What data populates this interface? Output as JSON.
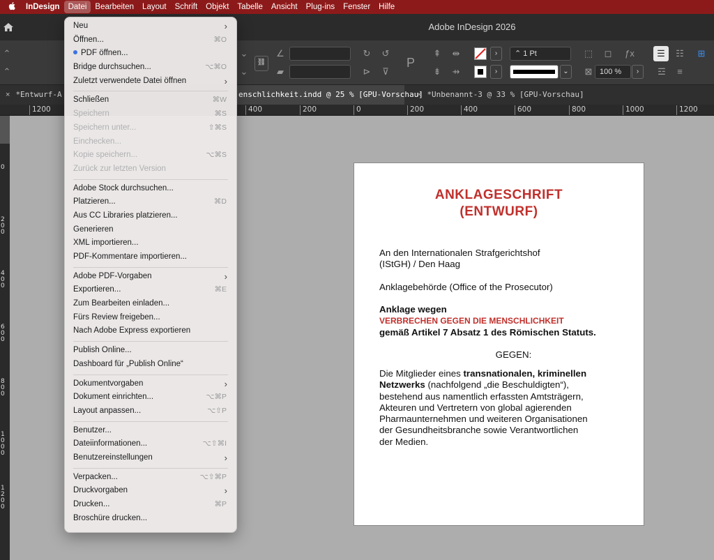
{
  "menubar": {
    "apple_icon": "",
    "items": [
      "InDesign",
      "Datei",
      "Bearbeiten",
      "Layout",
      "Schrift",
      "Objekt",
      "Tabelle",
      "Ansicht",
      "Plug-ins",
      "Fenster",
      "Hilfe"
    ],
    "active": "Datei",
    "bg_color": "#8d1a1a"
  },
  "window": {
    "title": "Adobe InDesign 2026"
  },
  "control_bar": {
    "stroke_weight": "1 Pt",
    "zoom": "100 %"
  },
  "tabs": [
    {
      "label": "*Entwurf-A",
      "close": "×"
    },
    {
      "label": "enschlichkeit.indd @ 25 % [GPU-Vorschau]",
      "close": ""
    },
    {
      "label": "*Unbenannt-3 @ 33 % [GPU-Vorschau]",
      "close": "×"
    }
  ],
  "ruler": {
    "ticks": [
      "1200",
      "400",
      "200",
      "0",
      "200",
      "400",
      "600",
      "800",
      "1000",
      "1200"
    ],
    "vticks": [
      [
        "0"
      ],
      [
        "2",
        "0",
        "0"
      ],
      [
        "4",
        "0",
        "0"
      ],
      [
        "6",
        "0",
        "0"
      ],
      [
        "8",
        "0",
        "0"
      ],
      [
        "1",
        "0",
        "0",
        "0"
      ],
      [
        "1",
        "2",
        "0",
        "0"
      ]
    ]
  },
  "menu": {
    "groups": [
      [
        {
          "label": "Neu",
          "shortcut": "",
          "submenu": true,
          "disabled": false
        },
        {
          "label": "Öffnen...",
          "shortcut": "⌘O",
          "submenu": false,
          "disabled": false
        },
        {
          "label": "PDF öffnen...",
          "shortcut": "",
          "submenu": false,
          "disabled": false,
          "dot": true
        },
        {
          "label": "Bridge durchsuchen...",
          "shortcut": "⌥⌘O",
          "submenu": false,
          "disabled": false
        },
        {
          "label": "Zuletzt verwendete Datei öffnen",
          "shortcut": "",
          "submenu": true,
          "disabled": false
        }
      ],
      [
        {
          "label": "Schließen",
          "shortcut": "⌘W",
          "submenu": false,
          "disabled": false
        },
        {
          "label": "Speichern",
          "shortcut": "⌘S",
          "submenu": false,
          "disabled": true
        },
        {
          "label": "Speichern unter...",
          "shortcut": "⇧⌘S",
          "submenu": false,
          "disabled": true
        },
        {
          "label": "Einchecken...",
          "shortcut": "",
          "submenu": false,
          "disabled": true
        },
        {
          "label": "Kopie speichern...",
          "shortcut": "⌥⌘S",
          "submenu": false,
          "disabled": true
        },
        {
          "label": "Zurück zur letzten Version",
          "shortcut": "",
          "submenu": false,
          "disabled": true
        }
      ],
      [
        {
          "label": "Adobe Stock durchsuchen...",
          "shortcut": "",
          "submenu": false,
          "disabled": false
        },
        {
          "label": "Platzieren...",
          "shortcut": "⌘D",
          "submenu": false,
          "disabled": false
        },
        {
          "label": "Aus CC Libraries platzieren...",
          "shortcut": "",
          "submenu": false,
          "disabled": false
        },
        {
          "label": "Generieren",
          "shortcut": "",
          "submenu": false,
          "disabled": false
        },
        {
          "label": "XML importieren...",
          "shortcut": "",
          "submenu": false,
          "disabled": false
        },
        {
          "label": "PDF-Kommentare importieren...",
          "shortcut": "",
          "submenu": false,
          "disabled": false
        }
      ],
      [
        {
          "label": "Adobe PDF-Vorgaben",
          "shortcut": "",
          "submenu": true,
          "disabled": false
        },
        {
          "label": "Exportieren...",
          "shortcut": "⌘E",
          "submenu": false,
          "disabled": false
        },
        {
          "label": "Zum Bearbeiten einladen...",
          "shortcut": "",
          "submenu": false,
          "disabled": false
        },
        {
          "label": "Fürs Review freigeben...",
          "shortcut": "",
          "submenu": false,
          "disabled": false
        },
        {
          "label": "Nach Adobe Express exportieren",
          "shortcut": "",
          "submenu": false,
          "disabled": false
        }
      ],
      [
        {
          "label": "Publish Online...",
          "shortcut": "",
          "submenu": false,
          "disabled": false
        },
        {
          "label": "Dashboard für „Publish Online“",
          "shortcut": "",
          "submenu": false,
          "disabled": false
        }
      ],
      [
        {
          "label": "Dokumentvorgaben",
          "shortcut": "",
          "submenu": true,
          "disabled": false
        },
        {
          "label": "Dokument einrichten...",
          "shortcut": "⌥⌘P",
          "submenu": false,
          "disabled": false
        },
        {
          "label": "Layout anpassen...",
          "shortcut": "⌥⇧P",
          "submenu": false,
          "disabled": false
        }
      ],
      [
        {
          "label": "Benutzer...",
          "shortcut": "",
          "submenu": false,
          "disabled": false
        },
        {
          "label": "Dateiinformationen...",
          "shortcut": "⌥⇧⌘I",
          "submenu": false,
          "disabled": false
        },
        {
          "label": "Benutzereinstellungen",
          "shortcut": "",
          "submenu": true,
          "disabled": false
        }
      ],
      [
        {
          "label": "Verpacken...",
          "shortcut": "⌥⇧⌘P",
          "submenu": false,
          "disabled": false
        },
        {
          "label": "Druckvorgaben",
          "shortcut": "",
          "submenu": true,
          "disabled": false
        },
        {
          "label": "Drucken...",
          "shortcut": "⌘P",
          "submenu": false,
          "disabled": false
        },
        {
          "label": "Broschüre drucken...",
          "shortcut": "",
          "submenu": false,
          "disabled": false
        }
      ]
    ]
  },
  "document": {
    "heading_line1": "ANKLAGESCHRIFT",
    "heading_line2": "(ENTWURF)",
    "addressee_line1": "An den Internationalen Strafgerichtshof",
    "addressee_line2": "(IStGH) / Den Haag",
    "authority": "Anklagebehörde (Office of the Prosecutor)",
    "charge_intro": "Anklage wegen",
    "charge_crime": "VERBRECHEN GEGEN DIE MENSCHLICHKEIT",
    "charge_basis": "gemäß Artikel 7 Absatz 1 des Römischen Statuts.",
    "against": "GEGEN:",
    "body_part1": "Die Mitglieder eines ",
    "body_bold1": "transnationalen, kriminellen",
    "body_bold2": "Netzwerks",
    "body_part2": " (nachfolgend „die Beschuldigten“),",
    "body_line3": "bestehend aus namentlich erfassten Amtsträgern,",
    "body_line4": "Akteuren und Vertretern von global agierenden",
    "body_line5": "Pharmaunternehmen und weiteren Organisationen",
    "body_line6": "der Gesundheitsbranche sowie Verantwortlichen",
    "body_line7": "der Medien."
  }
}
